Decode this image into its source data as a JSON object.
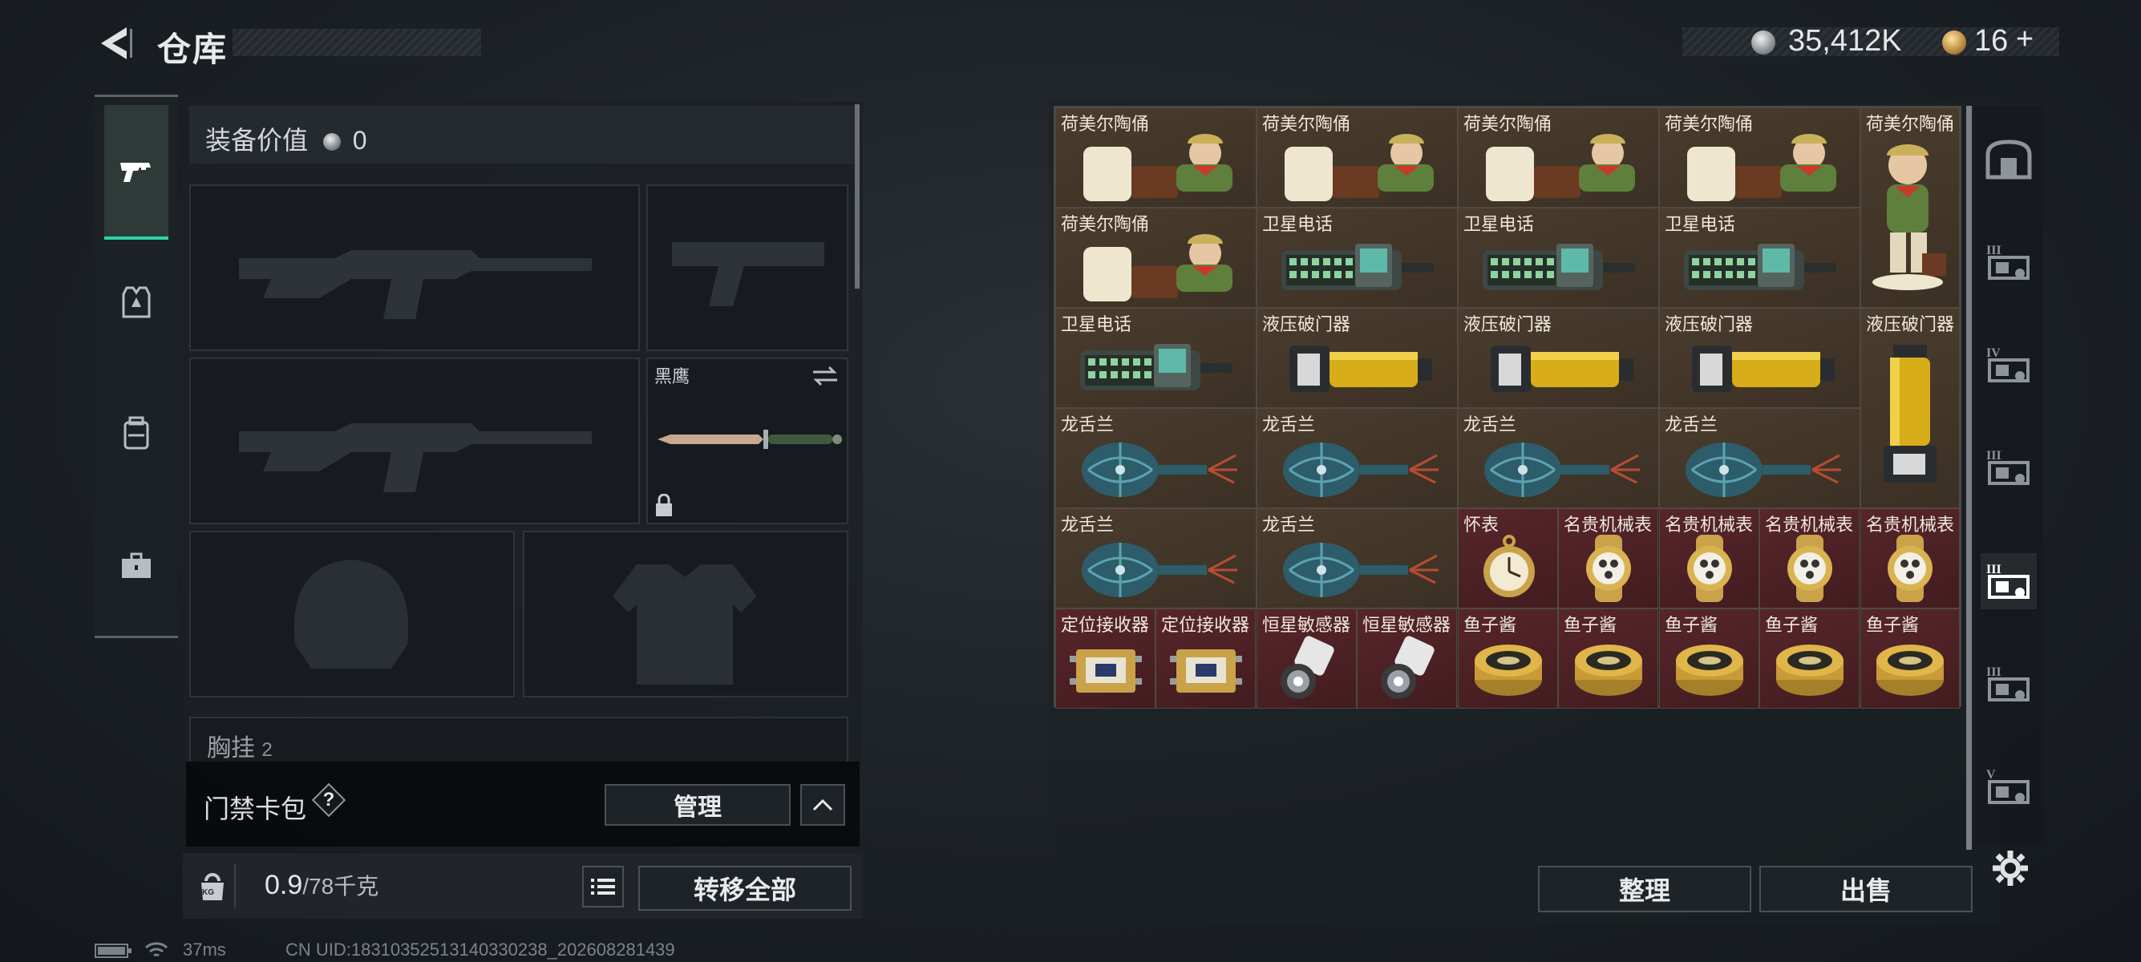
{
  "header": {
    "title": "仓库",
    "currency_value": "35,412K",
    "token_value": "16",
    "token_plus": "+"
  },
  "left_tabs": [
    {
      "icon": "pistol-icon",
      "active": true
    },
    {
      "icon": "armor-vest-icon",
      "active": false
    },
    {
      "icon": "backpack-icon",
      "active": false
    },
    {
      "icon": "toolbox-icon",
      "active": false
    }
  ],
  "equipment": {
    "value_label": "装备价值",
    "value": "0",
    "melee_name": "黑鹰",
    "chest_rig_label": "胸挂",
    "chest_rig_count": "2"
  },
  "keycard": {
    "label": "门禁卡包",
    "help": "?",
    "manage_label": "管理"
  },
  "weight": {
    "kg_badge": "KG",
    "current": "0.9",
    "max": "/78千克",
    "transfer_all_label": "转移全部"
  },
  "grid_items": [
    {
      "name": "荷美尔陶俑",
      "art": "figurine",
      "color": "brown"
    },
    {
      "name": "荷美尔陶俑",
      "art": "figurine",
      "color": "brown"
    },
    {
      "name": "荷美尔陶俑",
      "art": "figurine",
      "color": "brown"
    },
    {
      "name": "荷美尔陶俑",
      "art": "figurine",
      "color": "brown"
    },
    {
      "name": "荷美尔陶俑",
      "art": "figurine-tall",
      "color": "brown"
    },
    {
      "name": "荷美尔陶俑",
      "art": "figurine",
      "color": "brown"
    },
    {
      "name": "卫星电话",
      "art": "phone",
      "color": "brown"
    },
    {
      "name": "卫星电话",
      "art": "phone",
      "color": "brown"
    },
    {
      "name": "卫星电话",
      "art": "phone",
      "color": "brown"
    },
    {
      "name": "卫星电话",
      "art": "phone",
      "color": "brown"
    },
    {
      "name": "液压破门器",
      "art": "breacher",
      "color": "brown"
    },
    {
      "name": "液压破门器",
      "art": "breacher",
      "color": "brown"
    },
    {
      "name": "液压破门器",
      "art": "breacher",
      "color": "brown"
    },
    {
      "name": "液压破门器",
      "art": "breacher-tall",
      "color": "brown"
    },
    {
      "name": "龙舌兰",
      "art": "bottle",
      "color": "brown"
    },
    {
      "name": "龙舌兰",
      "art": "bottle",
      "color": "brown"
    },
    {
      "name": "龙舌兰",
      "art": "bottle",
      "color": "brown"
    },
    {
      "name": "龙舌兰",
      "art": "bottle",
      "color": "brown"
    },
    {
      "name": "龙舌兰",
      "art": "bottle",
      "color": "brown"
    },
    {
      "name": "龙舌兰",
      "art": "bottle",
      "color": "brown"
    },
    {
      "name": "怀表",
      "art": "pocketwatch",
      "color": "red"
    },
    {
      "name": "名贵机械表",
      "art": "watch",
      "color": "red"
    },
    {
      "name": "名贵机械表",
      "art": "watch",
      "color": "red"
    },
    {
      "name": "名贵机械表",
      "art": "watch",
      "color": "red"
    },
    {
      "name": "名贵机械表",
      "art": "watch",
      "color": "red"
    },
    {
      "name": "定位接收器",
      "art": "receiver",
      "color": "red"
    },
    {
      "name": "定位接收器",
      "art": "receiver",
      "color": "red"
    },
    {
      "name": "恒星敏感器",
      "art": "sensor",
      "color": "red"
    },
    {
      "name": "恒星敏感器",
      "art": "sensor",
      "color": "red"
    },
    {
      "name": "鱼子酱",
      "art": "caviar",
      "color": "red"
    },
    {
      "name": "鱼子酱",
      "art": "caviar",
      "color": "red"
    },
    {
      "name": "鱼子酱",
      "art": "caviar",
      "color": "red"
    },
    {
      "name": "鱼子酱",
      "art": "caviar",
      "color": "red"
    },
    {
      "name": "鱼子酱",
      "art": "caviar",
      "color": "red"
    }
  ],
  "right_tabs": [
    {
      "icon": "safe-box-icon",
      "roman": ""
    },
    {
      "icon": "storage-III-icon",
      "roman": "III"
    },
    {
      "icon": "storage-IV-icon",
      "roman": "IV"
    },
    {
      "icon": "storage-III-icon",
      "roman": "III"
    },
    {
      "icon": "storage-III-icon",
      "roman": "III"
    },
    {
      "icon": "storage-III-icon",
      "roman": "III"
    },
    {
      "icon": "storage-V-icon",
      "roman": "V"
    }
  ],
  "actions": {
    "sort_label": "整理",
    "sell_label": "出售"
  },
  "status_bar": {
    "ping": "37ms",
    "uid": "CN UID:18310352513140330238_202608281439"
  }
}
